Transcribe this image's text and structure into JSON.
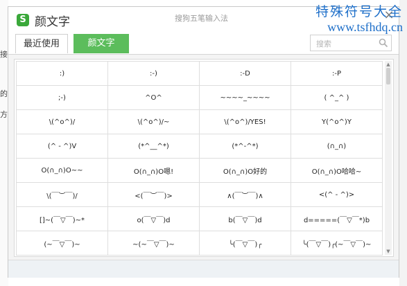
{
  "background": {
    "fragments": [
      "接",
      "的",
      "方法"
    ]
  },
  "window": {
    "logo_glyph": "S",
    "title": "颜文字",
    "subtitle": "搜狗五笔输入法",
    "close_glyph": "×"
  },
  "watermark": {
    "line1": "特殊符号大全",
    "line2": "www.tsfhdq.cn"
  },
  "tabs": {
    "recent": "最近使用",
    "kaomoji": "颜文字"
  },
  "search": {
    "placeholder": "搜索"
  },
  "accent_color": "#5cbd5c",
  "grid": [
    [
      ":)",
      ":-)",
      ":-D",
      ":-P"
    ],
    [
      ";-)",
      "^O^",
      "~~~~_~~~~",
      "( ^_^ )"
    ],
    [
      "\\(^o^)/",
      "\\(^o^)/~",
      "\\(^o^)/YES!",
      "Y(^o^)Y"
    ],
    [
      "(^ - ^)V",
      "(*^__^*)",
      "(*^-^*)",
      "(∩_∩)"
    ],
    [
      "O(∩_∩)O~~",
      "O(∩_∩)O嗯!",
      "O(∩_∩)O好的",
      "O(∩_∩)O哈哈~"
    ],
    [
      "\\(￣︶￣)/",
      "<(￣︶￣)>",
      "∧(￣︶￣)∧",
      "<(^ - ^)>"
    ],
    [
      "[]~(￣▽￣)~*",
      "o(￣▽￣)d",
      "b(￣▽￣)d",
      "d=====(￣▽￣*)b"
    ],
    [
      "(~￣▽￣)~",
      "~(~￣▽￣)~",
      "╰(￣▽￣)╭",
      "╰(￣▽￣)╭(~￣▽￣)~"
    ]
  ]
}
